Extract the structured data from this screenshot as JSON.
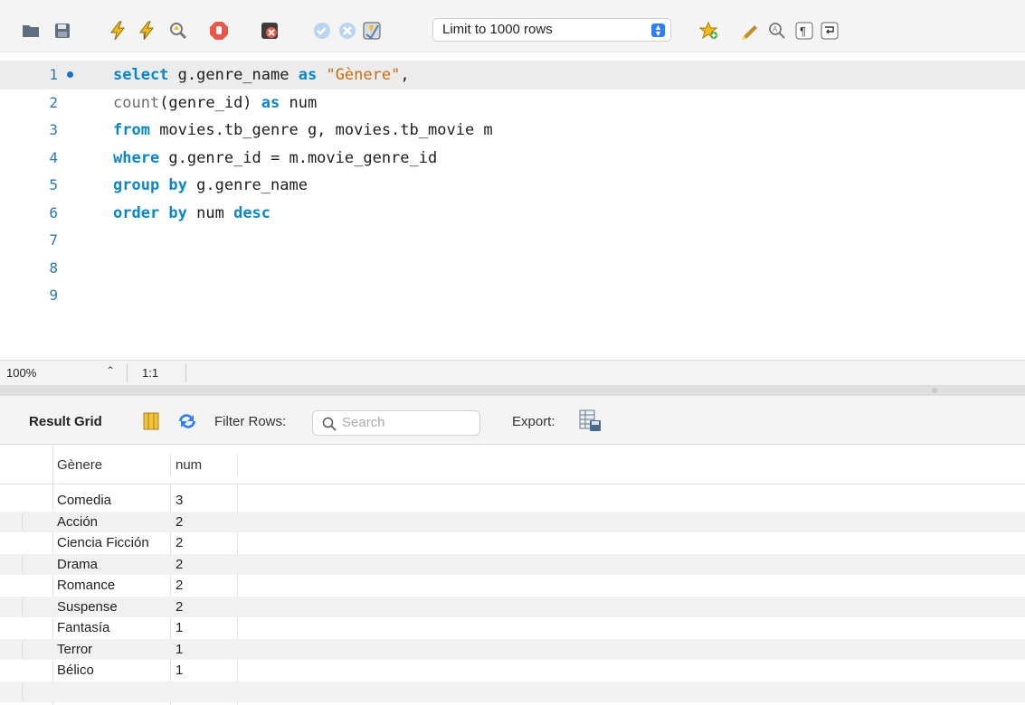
{
  "toolbar": {
    "buttons": [
      {
        "name": "open-folder-icon"
      },
      {
        "name": "save-icon"
      },
      {
        "name": "execute-icon"
      },
      {
        "name": "execute-current-icon"
      },
      {
        "name": "explain-icon"
      },
      {
        "name": "stop-icon"
      },
      {
        "name": "toggle-error-stop-icon"
      },
      {
        "name": "commit-icon"
      },
      {
        "name": "rollback-icon"
      },
      {
        "name": "autocommit-icon"
      },
      {
        "name": "add-snippet-icon"
      },
      {
        "name": "beautify-icon"
      },
      {
        "name": "find-icon"
      },
      {
        "name": "invisible-chars-icon"
      },
      {
        "name": "wrap-lines-icon"
      }
    ],
    "limit_select": "Limit to 1000 rows",
    "colors": {
      "accent": "#2f7ff2",
      "keyword": "#0d86c6",
      "string": "#d06a08",
      "line_number": "#2a79b6"
    }
  },
  "editor": {
    "lines": [
      {
        "num": "1",
        "tokens": [
          {
            "t": "select",
            "c": "kw"
          },
          {
            "t": " g.genre_name ",
            "c": ""
          },
          {
            "t": "as",
            "c": "kw"
          },
          {
            "t": " ",
            "c": ""
          },
          {
            "t": "\"Gènere\"",
            "c": "str"
          },
          {
            "t": ",",
            "c": ""
          }
        ]
      },
      {
        "num": "2",
        "tokens": [
          {
            "t": "count",
            "c": "fn"
          },
          {
            "t": "(genre_id) ",
            "c": ""
          },
          {
            "t": "as",
            "c": "kw"
          },
          {
            "t": " num",
            "c": ""
          }
        ]
      },
      {
        "num": "3",
        "tokens": [
          {
            "t": "from",
            "c": "kw"
          },
          {
            "t": " movies.tb_genre g, movies.tb_movie m",
            "c": ""
          }
        ]
      },
      {
        "num": "4",
        "tokens": [
          {
            "t": "where",
            "c": "kw"
          },
          {
            "t": " g.genre_id = m.movie_genre_id",
            "c": ""
          }
        ]
      },
      {
        "num": "5",
        "tokens": [
          {
            "t": "group by",
            "c": "kw"
          },
          {
            "t": " g.genre_name",
            "c": ""
          }
        ]
      },
      {
        "num": "6",
        "tokens": [
          {
            "t": "order by",
            "c": "kw"
          },
          {
            "t": " num ",
            "c": ""
          },
          {
            "t": "desc",
            "c": "kw"
          }
        ]
      },
      {
        "num": "7",
        "tokens": []
      },
      {
        "num": "8",
        "tokens": []
      },
      {
        "num": "9",
        "tokens": []
      }
    ]
  },
  "status": {
    "zoom": "100%",
    "cursor": "1:1"
  },
  "result": {
    "label": "Result Grid",
    "filter_label": "Filter Rows:",
    "search_placeholder": "Search",
    "export_label": "Export:",
    "columns": [
      "Gènere",
      "num"
    ],
    "rows": [
      [
        "Comedia",
        "3"
      ],
      [
        "Acción",
        "2"
      ],
      [
        "Ciencia Ficción",
        "2"
      ],
      [
        "Drama",
        "2"
      ],
      [
        "Romance",
        "2"
      ],
      [
        "Suspense",
        "2"
      ],
      [
        "Fantasía",
        "1"
      ],
      [
        "Terror",
        "1"
      ],
      [
        "Bélico",
        "1"
      ]
    ]
  }
}
